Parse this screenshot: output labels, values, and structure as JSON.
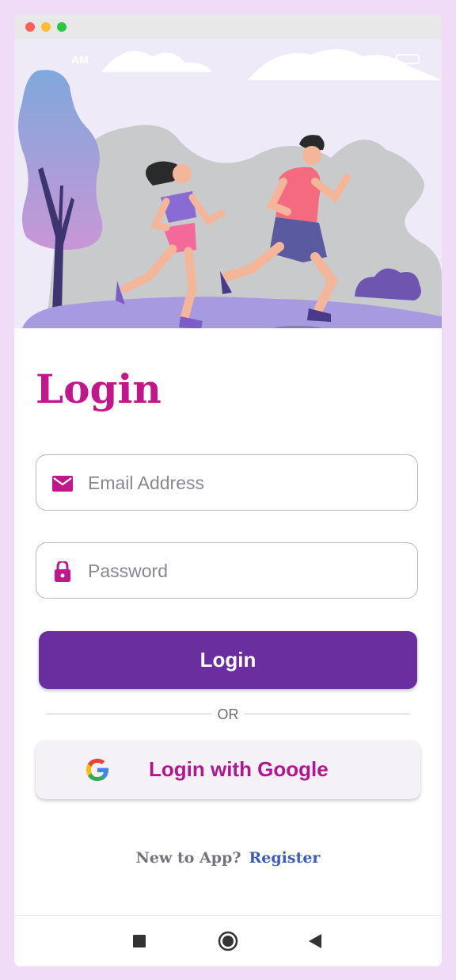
{
  "status_bar": {
    "time": "AM"
  },
  "login": {
    "title": "Login",
    "email": {
      "placeholder": "Email Address",
      "icon": "mail-icon"
    },
    "password": {
      "placeholder": "Password",
      "icon": "lock-icon"
    },
    "login_button": "Login",
    "or_text": "OR",
    "google_button": "Login with Google",
    "new_user_text": "New to App?",
    "register_link": "Register"
  },
  "nav": {
    "recents_icon": "square-icon",
    "home_icon": "circle-icon",
    "back_icon": "triangle-back-icon"
  },
  "colors": {
    "accent": "#c2178b",
    "primary_button": "#6a2e9e",
    "link": "#3b5bbd",
    "background": "#f1dcf8"
  }
}
